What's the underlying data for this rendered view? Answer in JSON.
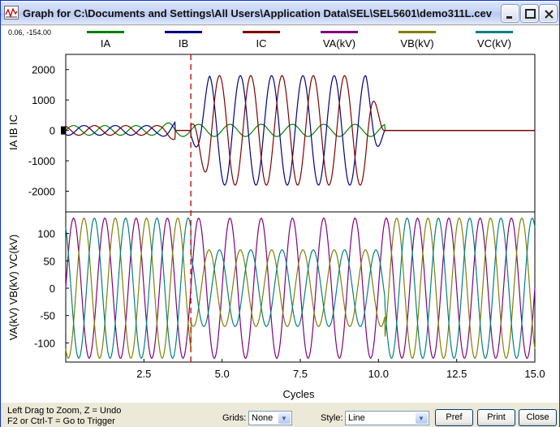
{
  "window": {
    "title": "Graph for C:\\Documents and Settings\\All Users\\Application Data\\SEL\\SEL5601\\demo311L.cev",
    "icon": "graph-window-icon"
  },
  "coord_readout": "0.06, -154.00",
  "legend": [
    {
      "label": "IA",
      "color": "#008000"
    },
    {
      "label": "IB",
      "color": "#000080"
    },
    {
      "label": "IC",
      "color": "#800000"
    },
    {
      "label": "VA(kV)",
      "color": "#800080"
    },
    {
      "label": "VB(kV)",
      "color": "#808000"
    },
    {
      "label": "VC(kV)",
      "color": "#008080"
    }
  ],
  "chart_data": [
    {
      "type": "line",
      "ylabel": "IA IB IC",
      "x_range": [
        0,
        15
      ],
      "ylim": [
        -2600,
        2500
      ],
      "y_ticks": [
        "2000",
        "1000",
        "0",
        "-1000",
        "-2000"
      ],
      "y_tick_values": [
        2000,
        1000,
        0,
        -1000,
        -2000
      ],
      "frequency_cycles_per_unit": 1,
      "trigger_cycle": 4.0,
      "series": [
        {
          "name": "IA",
          "color": "#008000",
          "segments": [
            {
              "from": 0,
              "to": 3.5,
              "amplitude": 160
            },
            {
              "from": 3.5,
              "to": 10.2,
              "amplitude": 200
            }
          ]
        },
        {
          "name": "IB",
          "color": "#000080",
          "segments": [
            {
              "from": 0,
              "to": 3.5,
              "amplitude": 160
            },
            {
              "from": 4.0,
              "to": 10.2,
              "amplitude": 1800
            }
          ]
        },
        {
          "name": "IC",
          "color": "#800000",
          "segments": [
            {
              "from": 0,
              "to": 3.5,
              "amplitude": 160
            },
            {
              "from": 4.0,
              "to": 10.2,
              "amplitude": 1800
            }
          ]
        }
      ]
    },
    {
      "type": "line",
      "ylabel": "VA(kV) VB(kV) VC(kV)",
      "xlabel": "Cycles",
      "x_range": [
        0,
        15
      ],
      "x_ticks": [
        "2.5",
        "5.0",
        "7.5",
        "10.0",
        "12.5",
        "15.0"
      ],
      "x_tick_values": [
        2.5,
        5.0,
        7.5,
        10.0,
        12.5,
        15.0
      ],
      "ylim": [
        -135,
        135
      ],
      "y_ticks": [
        "100",
        "50",
        "0",
        "-50",
        "-100"
      ],
      "y_tick_values": [
        100,
        50,
        0,
        -50,
        -100
      ],
      "series": [
        {
          "name": "VA(kV)",
          "color": "#800080",
          "pre_fault_amplitude": 128,
          "fault_amplitude": 128
        },
        {
          "name": "VB(kV)",
          "color": "#808000",
          "pre_fault_amplitude": 128,
          "fault_amplitude": 70
        },
        {
          "name": "VC(kV)",
          "color": "#008080",
          "pre_fault_amplitude": 128,
          "fault_amplitude": 70
        }
      ]
    }
  ],
  "status": {
    "hint_line1": "Left Drag to Zoom, Z = Undo",
    "hint_line2": "F2 or Ctrl-T = Go to Trigger",
    "grids_label": "Grids:",
    "grids_value": "None",
    "style_label": "Style:",
    "style_value": "Line",
    "pref_button": "Pref",
    "print_button": "Print",
    "close_button": "Close"
  }
}
